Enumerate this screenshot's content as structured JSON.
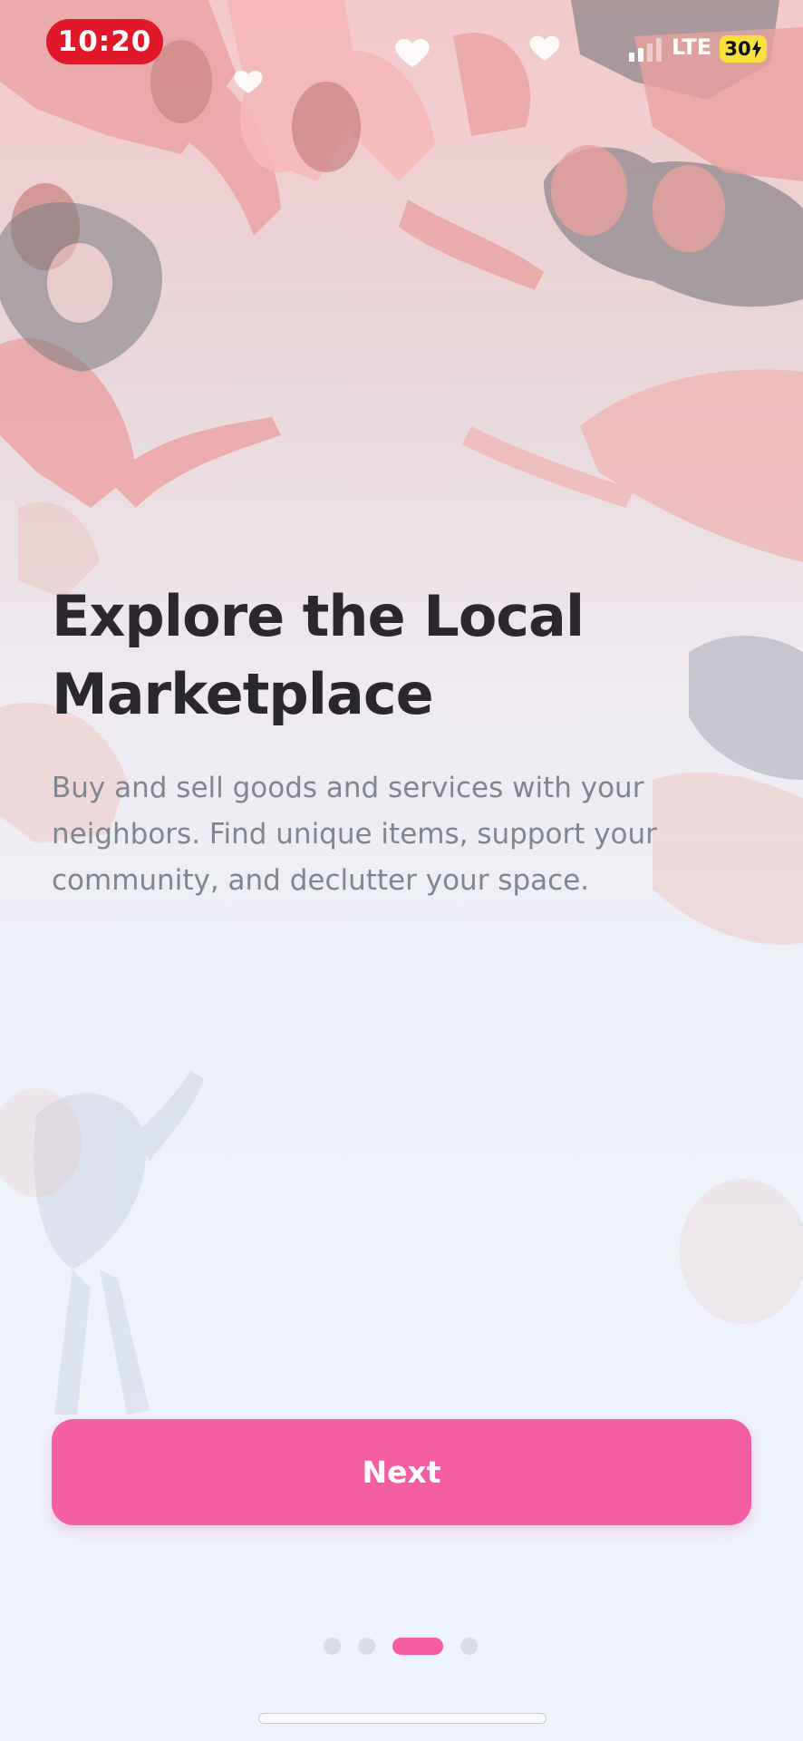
{
  "status_bar": {
    "time": "10:20",
    "network": "LTE",
    "battery": "30"
  },
  "onboarding": {
    "title": "Explore the Local Marketplace",
    "description": "Buy and sell goods and services with your neighbors. Find unique items, support your community, and declutter your space.",
    "next_label": "Next",
    "pages_total": 4,
    "current_page": 3
  },
  "colors": {
    "accent": "#f45ea2",
    "time_pill": "#e0182a",
    "battery": "#f7e23c",
    "title": "#2a282c",
    "body_text": "#7f868f"
  }
}
